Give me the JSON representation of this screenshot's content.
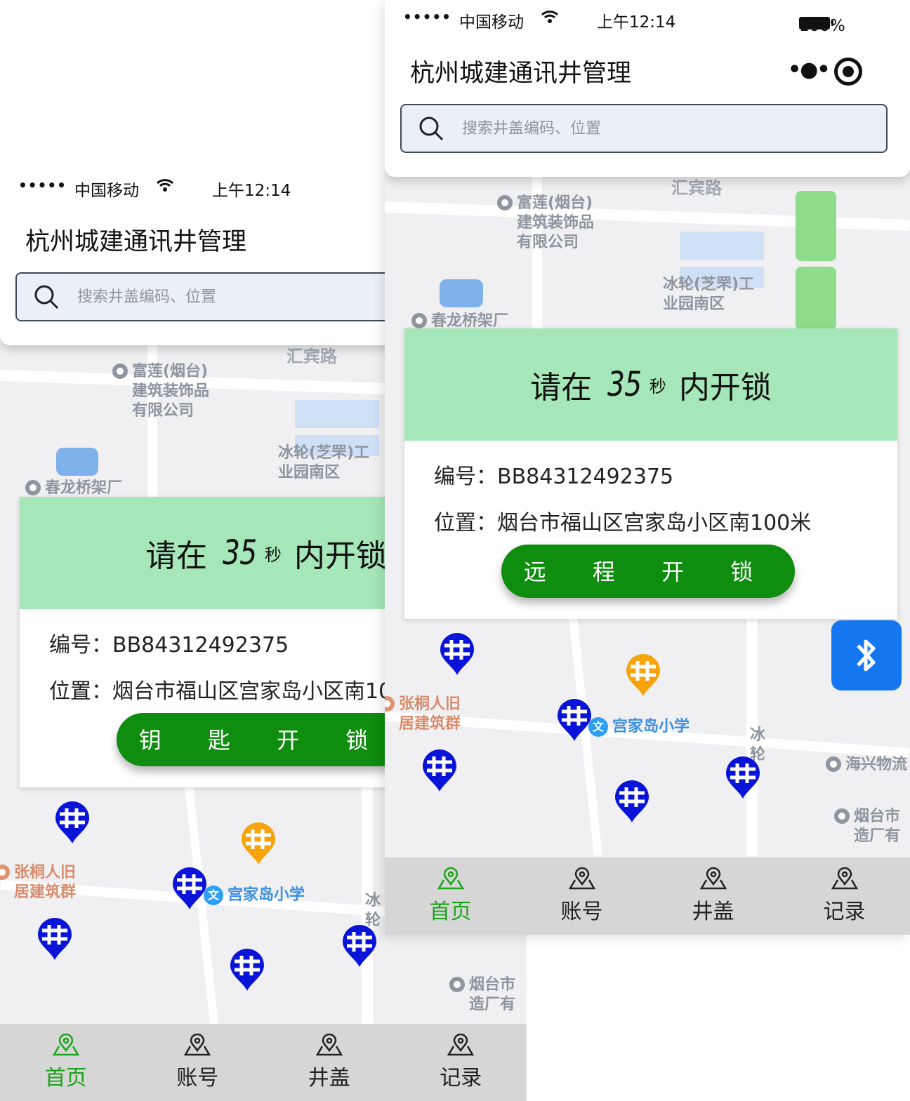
{
  "status": {
    "signal": "•••••",
    "carrier": "中国移动",
    "time": "上午12:14",
    "battery": "100%"
  },
  "app": {
    "title": "杭州城建通讯井管理"
  },
  "search": {
    "placeholder": "搜索井盖编码、位置"
  },
  "popup": {
    "prefix": "请在",
    "seconds": "35",
    "unit": "秒",
    "suffix": "内开锁",
    "id_label": "编号：",
    "id_value": "BB84312492375",
    "location_label": "位置：",
    "location_value": "烟台市福山区宫家岛小区南100米",
    "button_key": "钥 匙 开 锁",
    "button_remote": "远 程 开 锁"
  },
  "map_labels": {
    "road_1": "汇宾路",
    "poi_1": "富莲(烟台)\n建筑装饰品\n有限公司",
    "poi_2": "冰轮(芝罘)工\n业园南区",
    "poi_3": "春龙桥架厂",
    "poi_4": "张桐人旧\n居建筑群",
    "poi_5": "宫家岛小学",
    "poi_6": "海兴物流",
    "poi_7": "烟台市\n造厂有",
    "road_2": "冰\n轮",
    "school_icon": "文"
  },
  "tabs": [
    {
      "label": "首页",
      "icon": "map-pin-icon",
      "active": true
    },
    {
      "label": "账号",
      "icon": "map-pin-icon",
      "active": false
    },
    {
      "label": "井盖",
      "icon": "map-pin-icon",
      "active": false
    },
    {
      "label": "记录",
      "icon": "map-pin-icon",
      "active": false
    }
  ],
  "colors": {
    "active_tab": "#1aa41a",
    "button_green": "#0e8d0e",
    "popup_header": "#a6e7b9",
    "marker_blue": "#0a14d8",
    "marker_orange": "#f7a40c",
    "bluetooth_blue": "#1477f0"
  }
}
